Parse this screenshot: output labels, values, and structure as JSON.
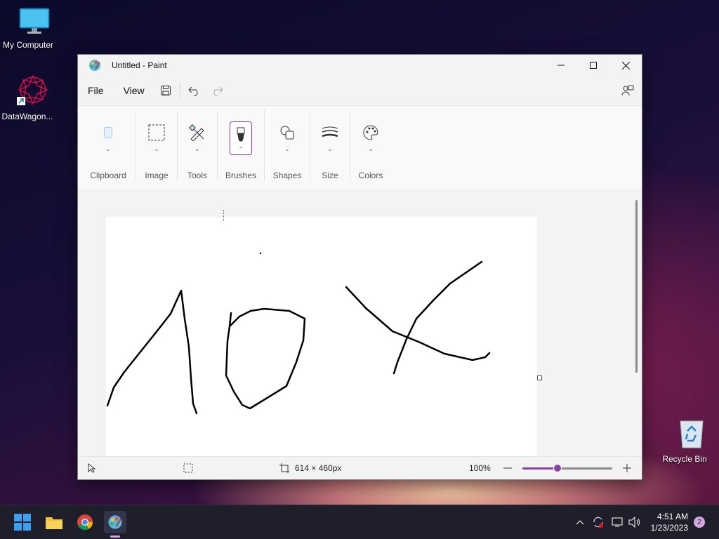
{
  "desktop": {
    "icons": [
      {
        "label": "My Computer"
      },
      {
        "label": "DataWagon..."
      },
      {
        "label": "Recycle Bin"
      }
    ]
  },
  "window": {
    "title": "Untitled - Paint",
    "menu": {
      "file": "File",
      "view": "View"
    },
    "ribbon_groups": {
      "clipboard": "Clipboard",
      "image": "Image",
      "tools": "Tools",
      "brushes": "Brushes",
      "shapes": "Shapes",
      "size": "Size",
      "colors": "Colors"
    },
    "status": {
      "canvas_size": "614 × 460px",
      "zoom": "100%",
      "zoom_slider_level": 0.39
    }
  },
  "taskbar": {
    "time": "4:51 AM",
    "date": "1/23/2023",
    "notification_count": "2"
  },
  "colors": {
    "accent": "#8a3fa3",
    "ink": "#000000"
  }
}
